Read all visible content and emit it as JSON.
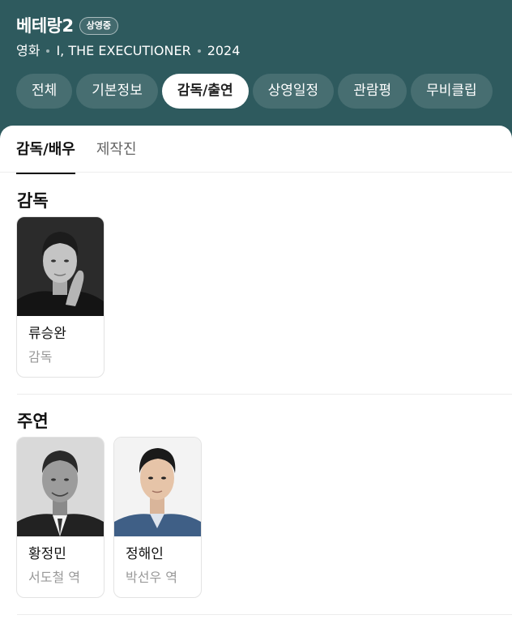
{
  "movie": {
    "title": "베테랑2",
    "badge": "상영중",
    "category": "영화",
    "original_title": "I, THE EXECUTIONER",
    "year": "2024"
  },
  "tabs": [
    {
      "label": "전체",
      "active": false
    },
    {
      "label": "기본정보",
      "active": false
    },
    {
      "label": "감독/출연",
      "active": true
    },
    {
      "label": "상영일정",
      "active": false
    },
    {
      "label": "관람평",
      "active": false
    },
    {
      "label": "무비클립",
      "active": false
    }
  ],
  "subtabs": [
    {
      "label": "감독/배우",
      "active": true
    },
    {
      "label": "제작진",
      "active": false
    }
  ],
  "sections": {
    "director": {
      "title": "감독",
      "people": [
        {
          "name": "류승완",
          "role": "감독"
        }
      ]
    },
    "lead": {
      "title": "주연",
      "people": [
        {
          "name": "황정민",
          "role": "서도철 역"
        },
        {
          "name": "정해인",
          "role": "박선우 역"
        }
      ]
    }
  }
}
